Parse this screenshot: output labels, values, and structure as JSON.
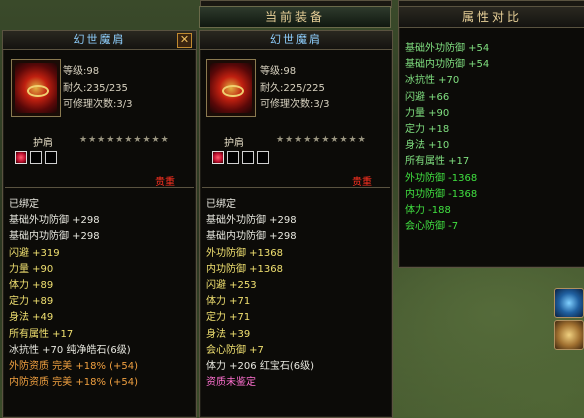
{
  "compare_header": "当前装备",
  "left": {
    "name": "幻世魔肩",
    "level": "等级:98",
    "durability": "耐久:235/235",
    "repairs": "可修理次数:3/3",
    "slot": "护肩",
    "stars": "★★★★★★★★★★",
    "gems": [
      true,
      false,
      false
    ],
    "rarity": "贵重",
    "stats": [
      {
        "text": "已绑定",
        "color": "white"
      },
      {
        "text": "基础外功防御 +298",
        "color": "white"
      },
      {
        "text": "基础内功防御 +298",
        "color": "white"
      },
      {
        "text": "闪避 +319",
        "color": "yellow"
      },
      {
        "text": "力量 +90",
        "color": "yellow"
      },
      {
        "text": "体力 +89",
        "color": "yellow"
      },
      {
        "text": "定力 +89",
        "color": "yellow"
      },
      {
        "text": "身法 +49",
        "color": "yellow"
      },
      {
        "text": "所有属性 +17",
        "color": "yellow"
      },
      {
        "text": "冰抗性 +70 纯净皓石(6级)",
        "color": "white"
      },
      {
        "text": "外防资质   完美 +18% (+54)",
        "color": "orange"
      },
      {
        "text": "内防资质   完美 +18% (+54)",
        "color": "orange"
      }
    ]
  },
  "right": {
    "name": "幻世魔肩",
    "level": "等级:98",
    "durability": "耐久:225/225",
    "repairs": "可修理次数:3/3",
    "slot": "护肩",
    "stars": "★★★★★★★★★★",
    "gems": [
      true,
      false,
      false,
      false
    ],
    "rarity": "贵重",
    "stats": [
      {
        "text": "已绑定",
        "color": "white"
      },
      {
        "text": "基础外功防御 +298",
        "color": "white"
      },
      {
        "text": "基础内功防御 +298",
        "color": "white"
      },
      {
        "text": "外功防御 +1368",
        "color": "yellow"
      },
      {
        "text": "内功防御 +1368",
        "color": "yellow"
      },
      {
        "text": "闪避 +253",
        "color": "yellow"
      },
      {
        "text": "体力 +71",
        "color": "yellow"
      },
      {
        "text": "定力 +71",
        "color": "yellow"
      },
      {
        "text": "身法 +39",
        "color": "yellow"
      },
      {
        "text": "会心防御 +7",
        "color": "yellow"
      },
      {
        "text": "体力 +206 红宝石(6级)",
        "color": "white"
      },
      {
        "text": "资质未鉴定",
        "color": "pink"
      }
    ]
  },
  "compare": {
    "title": "属性对比",
    "stats": [
      {
        "text": "基础外功防御 +54",
        "color": "lgreen"
      },
      {
        "text": "基础内功防御 +54",
        "color": "lgreen"
      },
      {
        "text": "冰抗性 +70",
        "color": "lgreen"
      },
      {
        "text": "闪避 +66",
        "color": "lgreen"
      },
      {
        "text": "力量 +90",
        "color": "lgreen"
      },
      {
        "text": "定力 +18",
        "color": "lgreen"
      },
      {
        "text": "身法 +10",
        "color": "lgreen"
      },
      {
        "text": "所有属性 +17",
        "color": "lgreen"
      },
      {
        "text": "外功防御 -1368",
        "color": "green"
      },
      {
        "text": "内功防御 -1368",
        "color": "green"
      },
      {
        "text": "体力 -188",
        "color": "green"
      },
      {
        "text": "会心防御 -7",
        "color": "green"
      }
    ]
  },
  "close_label": "✕",
  "icons": {
    "item": "shoulder-scroll-icon",
    "close": "close-icon",
    "skill_1": "blue-skill-icon",
    "skill_2": "golden-skill-icon"
  }
}
